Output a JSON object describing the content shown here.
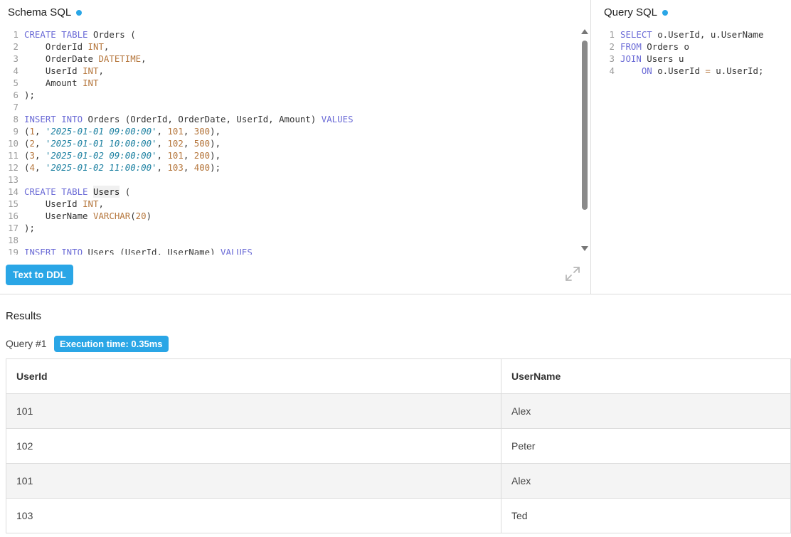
{
  "colors": {
    "accent": "#2aa6e6",
    "badge": "#2aa6e6"
  },
  "schema_panel": {
    "title": "Schema SQL",
    "lines": [
      {
        "n": "1",
        "tokens": [
          [
            "kw",
            "CREATE TABLE"
          ],
          [
            "tx",
            " Orders ("
          ]
        ]
      },
      {
        "n": "2",
        "tokens": [
          [
            "tx",
            "    OrderId "
          ],
          [
            "ty",
            "INT"
          ],
          [
            "tx",
            ","
          ]
        ]
      },
      {
        "n": "3",
        "tokens": [
          [
            "tx",
            "    OrderDate "
          ],
          [
            "ty",
            "DATETIME"
          ],
          [
            "tx",
            ","
          ]
        ]
      },
      {
        "n": "4",
        "tokens": [
          [
            "tx",
            "    UserId "
          ],
          [
            "ty",
            "INT"
          ],
          [
            "tx",
            ","
          ]
        ]
      },
      {
        "n": "5",
        "tokens": [
          [
            "tx",
            "    Amount "
          ],
          [
            "ty",
            "INT"
          ]
        ]
      },
      {
        "n": "6",
        "tokens": [
          [
            "tx",
            ");"
          ]
        ]
      },
      {
        "n": "7",
        "tokens": []
      },
      {
        "n": "8",
        "tokens": [
          [
            "kw",
            "INSERT INTO"
          ],
          [
            "tx",
            " Orders (OrderId, OrderDate, UserId, Amount) "
          ],
          [
            "kw",
            "VALUES"
          ]
        ]
      },
      {
        "n": "9",
        "tokens": [
          [
            "tx",
            "("
          ],
          [
            "nm",
            "1"
          ],
          [
            "tx",
            ", "
          ],
          [
            "st",
            "'2025-01-01 09:00:00'"
          ],
          [
            "tx",
            ", "
          ],
          [
            "nm",
            "101"
          ],
          [
            "tx",
            ", "
          ],
          [
            "nm",
            "300"
          ],
          [
            "tx",
            "),"
          ]
        ]
      },
      {
        "n": "10",
        "tokens": [
          [
            "tx",
            "("
          ],
          [
            "nm",
            "2"
          ],
          [
            "tx",
            ", "
          ],
          [
            "st",
            "'2025-01-01 10:00:00'"
          ],
          [
            "tx",
            ", "
          ],
          [
            "nm",
            "102"
          ],
          [
            "tx",
            ", "
          ],
          [
            "nm",
            "500"
          ],
          [
            "tx",
            "),"
          ]
        ]
      },
      {
        "n": "11",
        "tokens": [
          [
            "tx",
            "("
          ],
          [
            "nm",
            "3"
          ],
          [
            "tx",
            ", "
          ],
          [
            "st",
            "'2025-01-02 09:00:00'"
          ],
          [
            "tx",
            ", "
          ],
          [
            "nm",
            "101"
          ],
          [
            "tx",
            ", "
          ],
          [
            "nm",
            "200"
          ],
          [
            "tx",
            "),"
          ]
        ]
      },
      {
        "n": "12",
        "tokens": [
          [
            "tx",
            "("
          ],
          [
            "nm",
            "4"
          ],
          [
            "tx",
            ", "
          ],
          [
            "st",
            "'2025-01-02 11:00:00'"
          ],
          [
            "tx",
            ", "
          ],
          [
            "nm",
            "103"
          ],
          [
            "tx",
            ", "
          ],
          [
            "nm",
            "400"
          ],
          [
            "tx",
            ");"
          ]
        ]
      },
      {
        "n": "13",
        "tokens": []
      },
      {
        "n": "14",
        "tokens": [
          [
            "kw",
            "CREATE TABLE"
          ],
          [
            "tx",
            " "
          ],
          [
            "hl",
            "Users"
          ],
          [
            "tx",
            " ("
          ]
        ]
      },
      {
        "n": "15",
        "tokens": [
          [
            "tx",
            "    UserId "
          ],
          [
            "ty",
            "INT"
          ],
          [
            "tx",
            ","
          ]
        ]
      },
      {
        "n": "16",
        "tokens": [
          [
            "tx",
            "    UserName "
          ],
          [
            "ty",
            "VARCHAR"
          ],
          [
            "tx",
            "("
          ],
          [
            "nm",
            "20"
          ],
          [
            "tx",
            ")"
          ]
        ]
      },
      {
        "n": "17",
        "tokens": [
          [
            "tx",
            ");"
          ]
        ]
      },
      {
        "n": "18",
        "tokens": []
      },
      {
        "n": "19",
        "tokens": [
          [
            "kw",
            "INSERT INTO"
          ],
          [
            "tx",
            " Users (UserId, UserName) "
          ],
          [
            "kw",
            "VALUES"
          ]
        ]
      }
    ],
    "ddl_button": "Text to DDL",
    "expand_icon": "expand-icon"
  },
  "query_panel": {
    "title": "Query SQL",
    "lines": [
      {
        "n": "1",
        "tokens": [
          [
            "kw",
            "SELECT"
          ],
          [
            "tx",
            " o.UserId, u.UserName"
          ]
        ]
      },
      {
        "n": "2",
        "tokens": [
          [
            "kw",
            "FROM"
          ],
          [
            "tx",
            " Orders o"
          ]
        ]
      },
      {
        "n": "3",
        "tokens": [
          [
            "kw",
            "JOIN"
          ],
          [
            "tx",
            " Users u"
          ]
        ]
      },
      {
        "n": "4",
        "tokens": [
          [
            "tx",
            "    "
          ],
          [
            "kw",
            "ON"
          ],
          [
            "tx",
            " o.UserId "
          ],
          [
            "op",
            "="
          ],
          [
            "tx",
            " u.UserId;"
          ]
        ]
      }
    ]
  },
  "results": {
    "title": "Results",
    "query_label": "Query #1",
    "execution_badge": "Execution time: 0.35ms",
    "columns": [
      "UserId",
      "UserName"
    ],
    "rows": [
      [
        "101",
        "Alex"
      ],
      [
        "102",
        "Peter"
      ],
      [
        "101",
        "Alex"
      ],
      [
        "103",
        "Ted"
      ]
    ]
  }
}
